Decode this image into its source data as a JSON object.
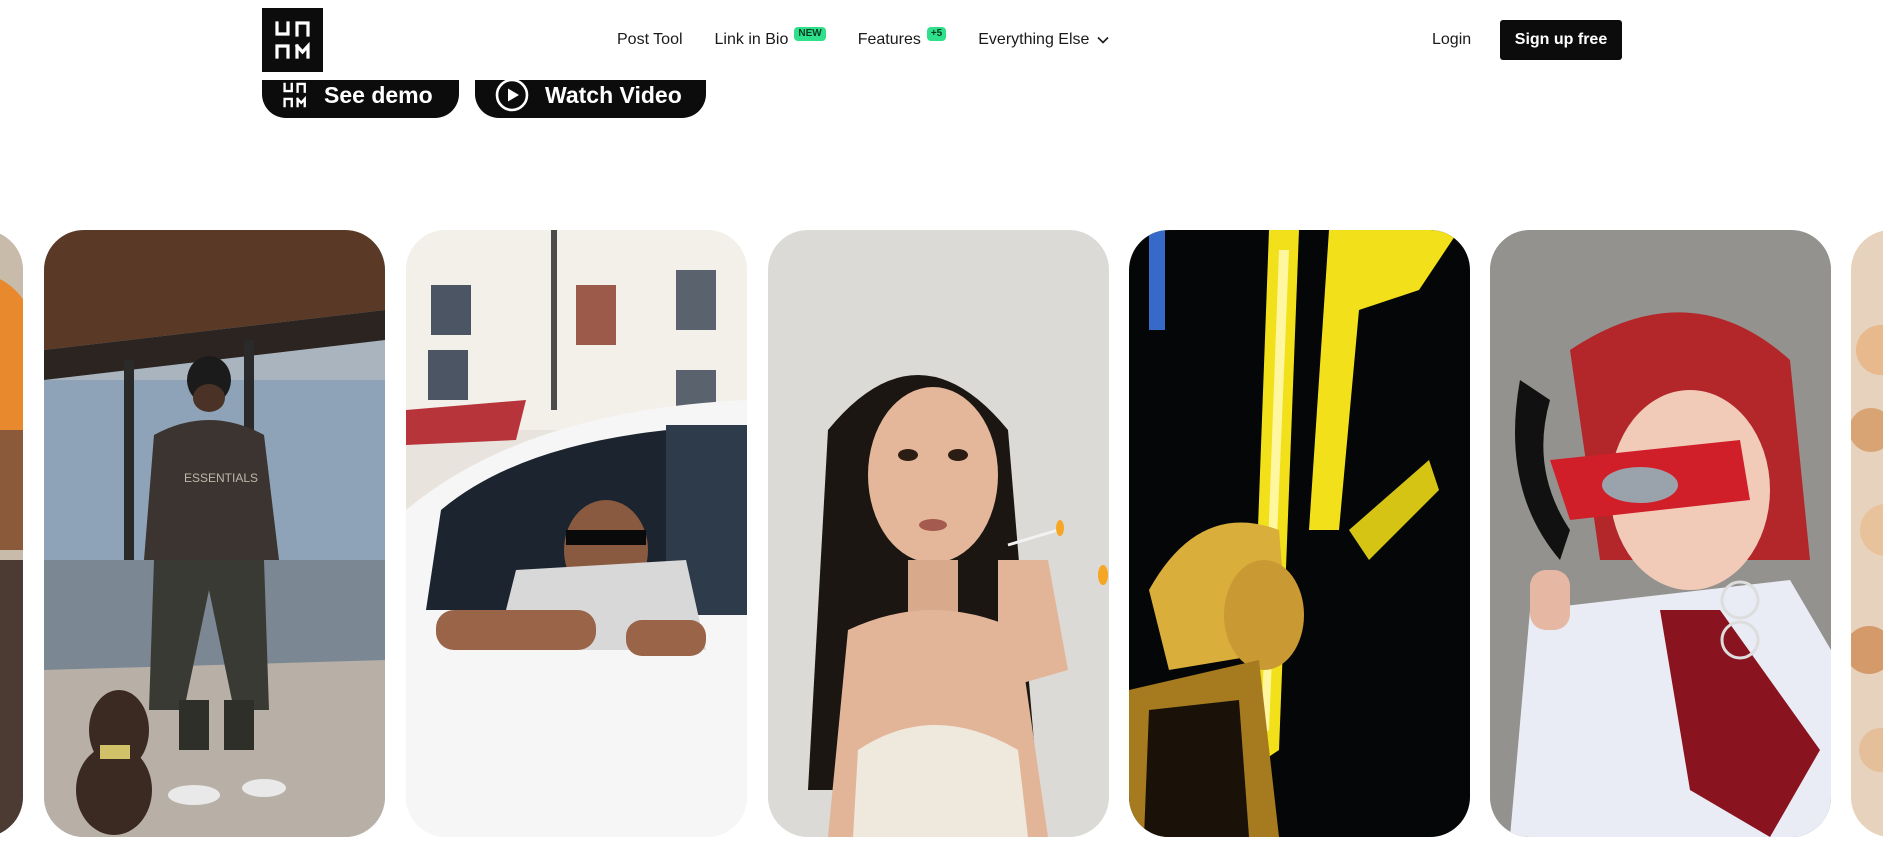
{
  "brand": {
    "logo_top": "UN",
    "logo_bottom": "UM"
  },
  "nav": {
    "items": [
      {
        "label": "Post Tool"
      },
      {
        "label": "Link in Bio",
        "badge": "NEW"
      },
      {
        "label": "Features",
        "badge": "+5"
      },
      {
        "label": "Everything Else"
      }
    ],
    "login": "Login",
    "signup": "Sign up free"
  },
  "cta": {
    "demo": "See demo",
    "video": "Watch Video"
  },
  "gallery": {
    "cards": [
      {
        "subject": "partial-orange-image"
      },
      {
        "subject": "man-in-hoodie-with-dog"
      },
      {
        "subject": "man-in-white-car"
      },
      {
        "subject": "woman-lighting-cigarette"
      },
      {
        "subject": "woman-with-yellow-neon"
      },
      {
        "subject": "red-haired-person-with-sunglasses"
      },
      {
        "subject": "partial-flowers-image"
      }
    ],
    "hoodie_text": "ESSENTIALS"
  },
  "colors": {
    "black": "#0c0c0c",
    "badge_green": "#2fe08a",
    "neon_yellow": "#f2e11a"
  }
}
